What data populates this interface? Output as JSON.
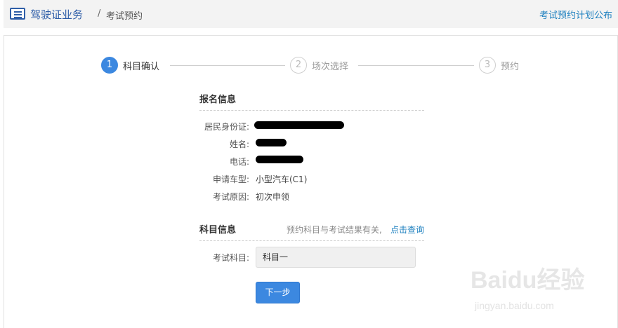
{
  "header": {
    "icon": "list-menu-icon",
    "title": "驾驶证业务",
    "separator": "/",
    "subtitle": "考试预约",
    "right_link": "考试预约计划公布"
  },
  "steps": [
    {
      "number": "1",
      "label": "科目确认",
      "state": "active"
    },
    {
      "number": "2",
      "label": "场次选择",
      "state": "inactive"
    },
    {
      "number": "3",
      "label": "预约",
      "state": "inactive"
    }
  ],
  "registration": {
    "title": "报名信息",
    "fields": [
      {
        "label": "居民身份证:",
        "value": "",
        "redacted": true
      },
      {
        "label": "姓名:",
        "value": "",
        "redacted": true
      },
      {
        "label": "电话:",
        "value": "",
        "redacted": true
      },
      {
        "label": "申请车型:",
        "value": "小型汽车(C1)"
      },
      {
        "label": "考试原因:",
        "value": "初次申领"
      }
    ]
  },
  "subject": {
    "title": "科目信息",
    "hint": "预约科目与考试结果有关,",
    "hint_link": "点击查询",
    "field_label": "考试科目:",
    "selected_value": "科目一"
  },
  "next_button": "下一步",
  "watermark": {
    "logo": "Baidu经验",
    "url": "jingyan.baidu.com"
  },
  "colors": {
    "accent": "#3c88e0",
    "brand_blue": "#2f5ea8",
    "link": "#1b7fbf",
    "header_bg": "#f3f3f3"
  }
}
